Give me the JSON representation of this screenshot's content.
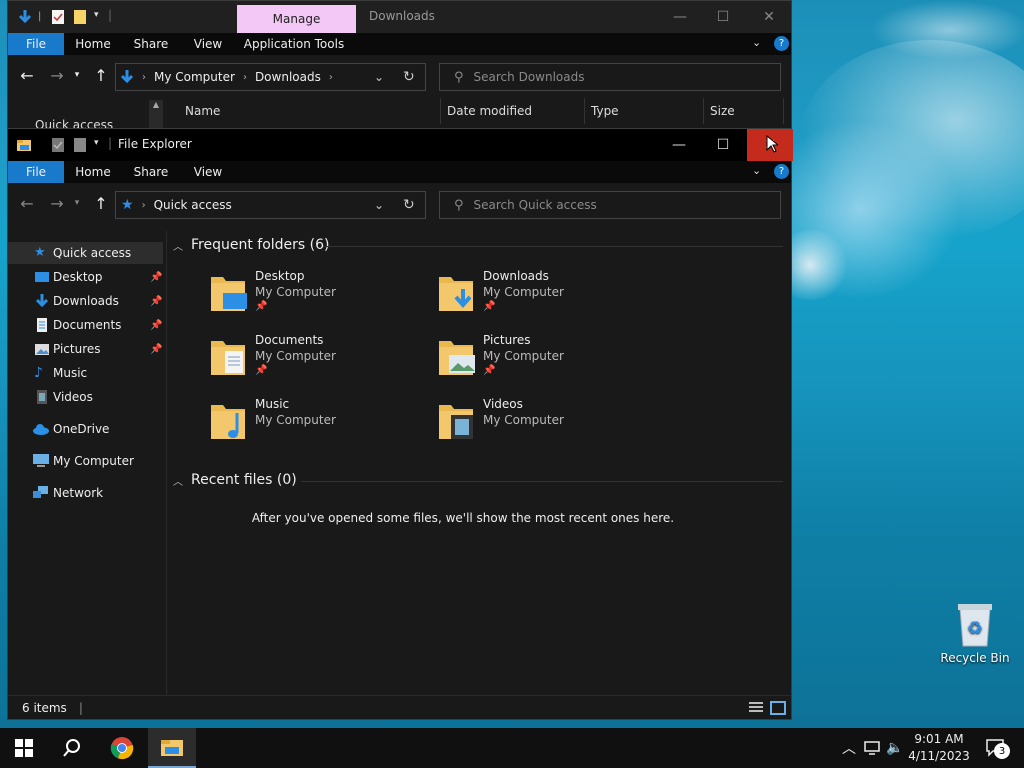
{
  "colors": {
    "accent": "#1979ca",
    "close_hover": "#c42b1c",
    "manage_tab": "#f3c8f6",
    "folder": "#f3c76b"
  },
  "back_window": {
    "manage_tab": "Manage",
    "title": "Downloads",
    "ribbon_tabs": [
      "File",
      "Home",
      "Share",
      "View",
      "Application Tools"
    ],
    "address": {
      "segments": [
        "My Computer",
        "Downloads"
      ]
    },
    "search_placeholder": "Search Downloads",
    "columns": [
      "Name",
      "Date modified",
      "Type",
      "Size"
    ],
    "sidebar_peek": "Quick access"
  },
  "front_window": {
    "title": "File Explorer",
    "ribbon_tabs": [
      "File",
      "Home",
      "Share",
      "View"
    ],
    "address": {
      "segments": [
        "Quick access"
      ]
    },
    "search_placeholder": "Search Quick access",
    "sidebar": {
      "items": [
        {
          "label": "Quick access",
          "icon": "star-icon",
          "pinned": false,
          "selected": true
        },
        {
          "label": "Desktop",
          "icon": "desktop-icon",
          "pinned": true
        },
        {
          "label": "Downloads",
          "icon": "download-arrow-icon",
          "pinned": true
        },
        {
          "label": "Documents",
          "icon": "document-icon",
          "pinned": true
        },
        {
          "label": "Pictures",
          "icon": "pictures-icon",
          "pinned": true
        },
        {
          "label": "Music",
          "icon": "music-note-icon",
          "pinned": false
        },
        {
          "label": "Videos",
          "icon": "video-icon",
          "pinned": false
        },
        {
          "label": "OneDrive",
          "icon": "cloud-icon",
          "pinned": false
        },
        {
          "label": "My Computer",
          "icon": "computer-icon",
          "pinned": false
        },
        {
          "label": "Network",
          "icon": "network-icon",
          "pinned": false
        }
      ]
    },
    "frequent_header": "Frequent folders (6)",
    "folders": [
      {
        "name": "Desktop",
        "location": "My Computer",
        "pinned": true
      },
      {
        "name": "Downloads",
        "location": "My Computer",
        "pinned": true
      },
      {
        "name": "Documents",
        "location": "My Computer",
        "pinned": true
      },
      {
        "name": "Pictures",
        "location": "My Computer",
        "pinned": true
      },
      {
        "name": "Music",
        "location": "My Computer",
        "pinned": false
      },
      {
        "name": "Videos",
        "location": "My Computer",
        "pinned": false
      }
    ],
    "recent_header": "Recent files (0)",
    "recent_empty": "After you've opened some files, we'll show the most recent ones here.",
    "status": "6 items"
  },
  "desktop": {
    "recycle_bin": "Recycle Bin"
  },
  "taskbar": {
    "time": "9:01 AM",
    "date": "4/11/2023",
    "notification_count": "3"
  }
}
